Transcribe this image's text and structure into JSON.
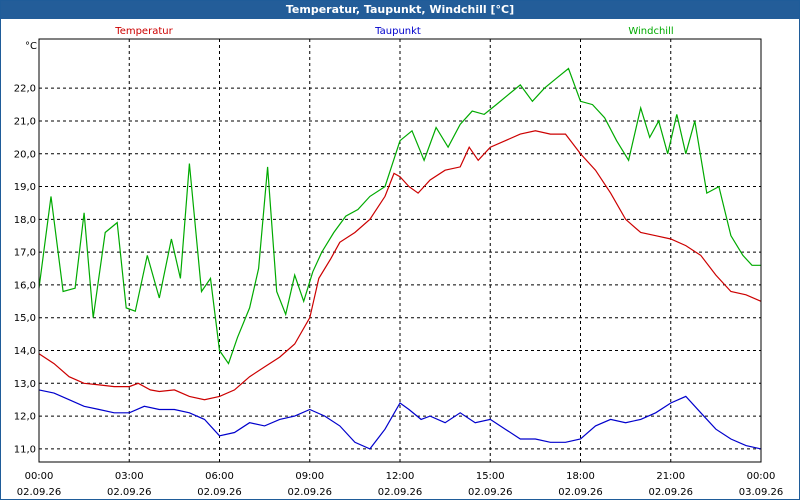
{
  "window": {
    "title": "Temperatur, Taupunkt, Windchill [°C]"
  },
  "chart_data": {
    "type": "line",
    "title": "Temperatur, Taupunkt, Windchill [°C]",
    "ylabel": "°C",
    "ylim": [
      10.6,
      23.5
    ],
    "yticks": [
      "11,0",
      "12,0",
      "13,0",
      "14,0",
      "15,0",
      "16,0",
      "17,0",
      "18,0",
      "19,0",
      "20,0",
      "21,0",
      "22,0"
    ],
    "yticks_values": [
      11,
      12,
      13,
      14,
      15,
      16,
      17,
      18,
      19,
      20,
      21,
      22
    ],
    "xlim": [
      0,
      24
    ],
    "xticks": [
      {
        "time": "00:00",
        "date": "02.09.26",
        "hour": 0
      },
      {
        "time": "03:00",
        "date": "02.09.26",
        "hour": 3
      },
      {
        "time": "06:00",
        "date": "02.09.26",
        "hour": 6
      },
      {
        "time": "09:00",
        "date": "02.09.26",
        "hour": 9
      },
      {
        "time": "12:00",
        "date": "02.09.26",
        "hour": 12
      },
      {
        "time": "15:00",
        "date": "02.09.26",
        "hour": 15
      },
      {
        "time": "18:00",
        "date": "02.09.26",
        "hour": 18
      },
      {
        "time": "21:00",
        "date": "02.09.26",
        "hour": 21
      },
      {
        "time": "00:00",
        "date": "03.09.26",
        "hour": 24
      }
    ],
    "grid": true,
    "legend_position": "top",
    "series": [
      {
        "name": "Temperatur",
        "color": "#cc0000",
        "points": [
          [
            0,
            13.9
          ],
          [
            0.5,
            13.6
          ],
          [
            1,
            13.2
          ],
          [
            1.5,
            13.0
          ],
          [
            2,
            12.95
          ],
          [
            2.5,
            12.9
          ],
          [
            3,
            12.9
          ],
          [
            3.3,
            13.0
          ],
          [
            3.7,
            12.8
          ],
          [
            4,
            12.75
          ],
          [
            4.5,
            12.8
          ],
          [
            5,
            12.6
          ],
          [
            5.5,
            12.5
          ],
          [
            6,
            12.6
          ],
          [
            6.5,
            12.8
          ],
          [
            7,
            13.2
          ],
          [
            7.5,
            13.5
          ],
          [
            8,
            13.8
          ],
          [
            8.5,
            14.2
          ],
          [
            9,
            15.0
          ],
          [
            9.3,
            16.2
          ],
          [
            9.7,
            16.8
          ],
          [
            10,
            17.3
          ],
          [
            10.5,
            17.6
          ],
          [
            11,
            18.0
          ],
          [
            11.5,
            18.7
          ],
          [
            11.8,
            19.4
          ],
          [
            12,
            19.3
          ],
          [
            12.3,
            19.0
          ],
          [
            12.6,
            18.8
          ],
          [
            13,
            19.2
          ],
          [
            13.5,
            19.5
          ],
          [
            14,
            19.6
          ],
          [
            14.3,
            20.2
          ],
          [
            14.6,
            19.8
          ],
          [
            15,
            20.2
          ],
          [
            15.5,
            20.4
          ],
          [
            16,
            20.6
          ],
          [
            16.5,
            20.7
          ],
          [
            17,
            20.6
          ],
          [
            17.5,
            20.6
          ],
          [
            18,
            20.0
          ],
          [
            18.5,
            19.5
          ],
          [
            19,
            18.8
          ],
          [
            19.5,
            18.0
          ],
          [
            20,
            17.6
          ],
          [
            20.5,
            17.5
          ],
          [
            21,
            17.4
          ],
          [
            21.5,
            17.2
          ],
          [
            22,
            16.9
          ],
          [
            22.5,
            16.3
          ],
          [
            23,
            15.8
          ],
          [
            23.5,
            15.7
          ],
          [
            24,
            15.5
          ]
        ]
      },
      {
        "name": "Taupunkt",
        "color": "#0000cc",
        "points": [
          [
            0,
            12.8
          ],
          [
            0.5,
            12.7
          ],
          [
            1,
            12.5
          ],
          [
            1.5,
            12.3
          ],
          [
            2,
            12.2
          ],
          [
            2.5,
            12.1
          ],
          [
            3,
            12.1
          ],
          [
            3.5,
            12.3
          ],
          [
            4,
            12.2
          ],
          [
            4.5,
            12.2
          ],
          [
            5,
            12.1
          ],
          [
            5.5,
            11.9
          ],
          [
            6,
            11.4
          ],
          [
            6.5,
            11.5
          ],
          [
            7,
            11.8
          ],
          [
            7.5,
            11.7
          ],
          [
            8,
            11.9
          ],
          [
            8.5,
            12.0
          ],
          [
            9,
            12.2
          ],
          [
            9.5,
            12.0
          ],
          [
            10,
            11.7
          ],
          [
            10.5,
            11.2
          ],
          [
            11,
            11.0
          ],
          [
            11.5,
            11.6
          ],
          [
            12,
            12.4
          ],
          [
            12.3,
            12.2
          ],
          [
            12.7,
            11.9
          ],
          [
            13,
            12.0
          ],
          [
            13.5,
            11.8
          ],
          [
            14,
            12.1
          ],
          [
            14.5,
            11.8
          ],
          [
            15,
            11.9
          ],
          [
            15.5,
            11.6
          ],
          [
            16,
            11.3
          ],
          [
            16.5,
            11.3
          ],
          [
            17,
            11.2
          ],
          [
            17.5,
            11.2
          ],
          [
            18,
            11.3
          ],
          [
            18.5,
            11.7
          ],
          [
            19,
            11.9
          ],
          [
            19.5,
            11.8
          ],
          [
            20,
            11.9
          ],
          [
            20.5,
            12.1
          ],
          [
            21,
            12.4
          ],
          [
            21.5,
            12.6
          ],
          [
            22,
            12.1
          ],
          [
            22.5,
            11.6
          ],
          [
            23,
            11.3
          ],
          [
            23.5,
            11.1
          ],
          [
            24,
            11.0
          ]
        ]
      },
      {
        "name": "Windchill",
        "color": "#00aa00",
        "points": [
          [
            0,
            15.9
          ],
          [
            0.4,
            18.7
          ],
          [
            0.8,
            15.8
          ],
          [
            1.2,
            15.9
          ],
          [
            1.5,
            18.2
          ],
          [
            1.8,
            15.0
          ],
          [
            2.2,
            17.6
          ],
          [
            2.6,
            17.9
          ],
          [
            2.9,
            15.3
          ],
          [
            3.2,
            15.2
          ],
          [
            3.6,
            16.9
          ],
          [
            4,
            15.6
          ],
          [
            4.4,
            17.4
          ],
          [
            4.7,
            16.2
          ],
          [
            5,
            19.7
          ],
          [
            5.4,
            15.8
          ],
          [
            5.7,
            16.2
          ],
          [
            6,
            14.0
          ],
          [
            6.3,
            13.6
          ],
          [
            6.6,
            14.4
          ],
          [
            7,
            15.3
          ],
          [
            7.3,
            16.5
          ],
          [
            7.6,
            19.6
          ],
          [
            7.9,
            15.8
          ],
          [
            8.2,
            15.1
          ],
          [
            8.5,
            16.3
          ],
          [
            8.8,
            15.5
          ],
          [
            9.1,
            16.4
          ],
          [
            9.4,
            17.0
          ],
          [
            9.8,
            17.6
          ],
          [
            10.2,
            18.1
          ],
          [
            10.6,
            18.3
          ],
          [
            11,
            18.7
          ],
          [
            11.5,
            19.0
          ],
          [
            12,
            20.4
          ],
          [
            12.4,
            20.7
          ],
          [
            12.8,
            19.8
          ],
          [
            13.2,
            20.8
          ],
          [
            13.6,
            20.2
          ],
          [
            14,
            20.9
          ],
          [
            14.4,
            21.3
          ],
          [
            14.8,
            21.2
          ],
          [
            15.2,
            21.5
          ],
          [
            15.6,
            21.8
          ],
          [
            16,
            22.1
          ],
          [
            16.4,
            21.6
          ],
          [
            16.8,
            22.0
          ],
          [
            17.2,
            22.3
          ],
          [
            17.6,
            22.6
          ],
          [
            18,
            21.6
          ],
          [
            18.4,
            21.5
          ],
          [
            18.8,
            21.1
          ],
          [
            19.2,
            20.4
          ],
          [
            19.6,
            19.8
          ],
          [
            20,
            21.4
          ],
          [
            20.3,
            20.5
          ],
          [
            20.6,
            21.0
          ],
          [
            20.9,
            20.0
          ],
          [
            21.2,
            21.2
          ],
          [
            21.5,
            20.0
          ],
          [
            21.8,
            21.0
          ],
          [
            22.2,
            18.8
          ],
          [
            22.6,
            19.0
          ],
          [
            23,
            17.5
          ],
          [
            23.4,
            16.9
          ],
          [
            23.7,
            16.6
          ],
          [
            24,
            16.6
          ]
        ]
      }
    ]
  }
}
